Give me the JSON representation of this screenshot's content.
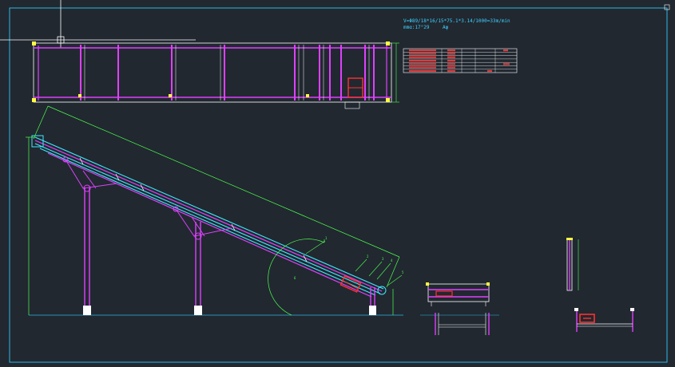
{
  "notes": {
    "formula_line": "V=Φ89/18*16/15*75.1*3.14/1000=33m/min",
    "spec_line_a": "mmα:17°29",
    "spec_line_b": "Aφ"
  },
  "table": {
    "rows": [
      [
        "",
        "",
        "",
        ""
      ],
      [
        "",
        "",
        "",
        ""
      ],
      [
        "",
        "",
        "",
        ""
      ],
      [
        "",
        "",
        "",
        ""
      ],
      [
        "",
        "",
        "",
        ""
      ],
      [
        "",
        "",
        "",
        ""
      ],
      [
        "",
        "",
        "",
        ""
      ]
    ]
  },
  "dims": {
    "slope_length": "",
    "height": "",
    "angle": "",
    "side_height": ""
  },
  "callouts": [
    "1",
    "2",
    "3",
    "4",
    "5",
    "6"
  ],
  "colors": {
    "background": "#212830",
    "border": "#2fb6e6",
    "frame": "#e040ff",
    "belt": "#40e8ff",
    "dimension": "#4cff4c",
    "hardware": "#ff3030",
    "marker": "#ffff40",
    "outline": "#ffffff"
  }
}
